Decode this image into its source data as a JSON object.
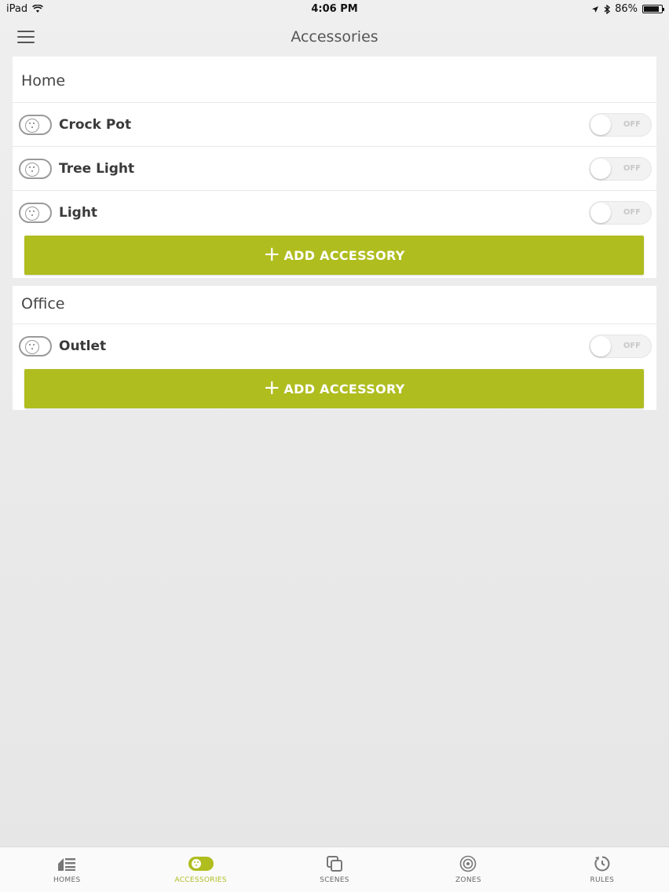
{
  "status_bar": {
    "device": "iPad",
    "time": "4:06 PM",
    "battery": "86%",
    "battery_level": 0.86
  },
  "nav": {
    "title": "Accessories"
  },
  "sections": [
    {
      "title": "Home",
      "accessories": [
        {
          "name": "Crock Pot",
          "state": "OFF"
        },
        {
          "name": "Tree Light",
          "state": "OFF"
        },
        {
          "name": "Light",
          "state": "OFF"
        }
      ],
      "add_label": "ADD ACCESSORY"
    },
    {
      "title": "Office",
      "accessories": [
        {
          "name": "Outlet",
          "state": "OFF"
        }
      ],
      "add_label": "ADD ACCESSORY"
    }
  ],
  "tabs": [
    {
      "label": "HOMES",
      "icon": "homes-icon",
      "active": false
    },
    {
      "label": "ACCESSORIES",
      "icon": "accessories-icon",
      "active": true
    },
    {
      "label": "SCENES",
      "icon": "scenes-icon",
      "active": false
    },
    {
      "label": "ZONES",
      "icon": "zones-icon",
      "active": false
    },
    {
      "label": "RULES",
      "icon": "rules-icon",
      "active": false
    }
  ],
  "colors": {
    "accent": "#afbd1f",
    "background": "#ececec",
    "card": "#ffffff"
  }
}
